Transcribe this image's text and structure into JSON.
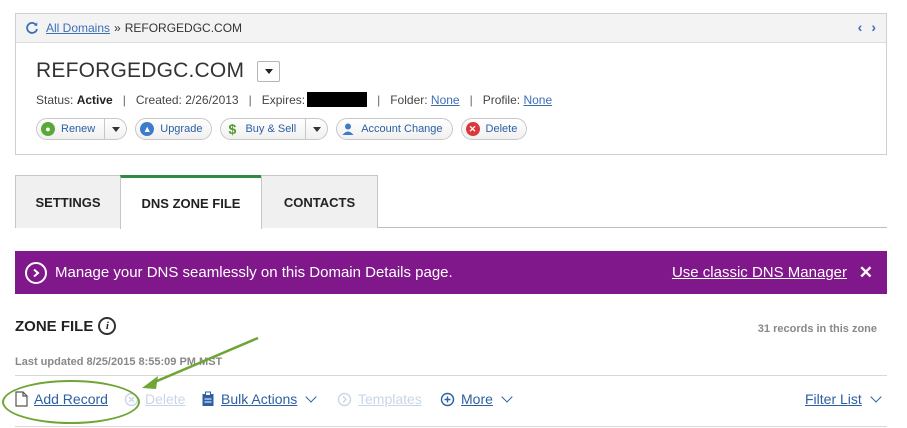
{
  "breadcrumb": {
    "root_label": "All Domains",
    "separator": "»",
    "current": "REFORGEDGC.COM",
    "prev": "‹",
    "next": "›"
  },
  "domain": {
    "name": "REFORGEDGC.COM",
    "status_label": "Status:",
    "status_value": "Active",
    "created_label": "Created: 2/26/2013",
    "expires_label": "Expires:",
    "folder_label": "Folder:",
    "folder_value": "None",
    "profile_label": "Profile:",
    "profile_value": "None",
    "pipe": "|"
  },
  "actions": {
    "renew": "Renew",
    "upgrade": "Upgrade",
    "buy_sell": "Buy & Sell",
    "account_change": "Account Change",
    "delete": "Delete"
  },
  "tabs": [
    {
      "label": "SETTINGS",
      "active": false
    },
    {
      "label": "DNS ZONE FILE",
      "active": true
    },
    {
      "label": "CONTACTS",
      "active": false
    }
  ],
  "banner": {
    "message": "Manage your DNS seamlessly on this Domain Details page.",
    "link": "Use classic DNS Manager",
    "close": "✕",
    "color": "#80178a"
  },
  "zone": {
    "title": "ZONE FILE",
    "info": "i",
    "records_count": "31 records in this zone",
    "last_updated": "Last updated 8/25/2015 8:55:09 PM MST"
  },
  "toolbar": {
    "add_record": "Add Record",
    "delete": "Delete",
    "bulk_actions": "Bulk Actions",
    "templates": "Templates",
    "more": "More",
    "filter_list": "Filter List"
  },
  "colors": {
    "link": "#2c5fa4",
    "active_tab": "#2f8a44",
    "annotation": "#6fa534"
  }
}
